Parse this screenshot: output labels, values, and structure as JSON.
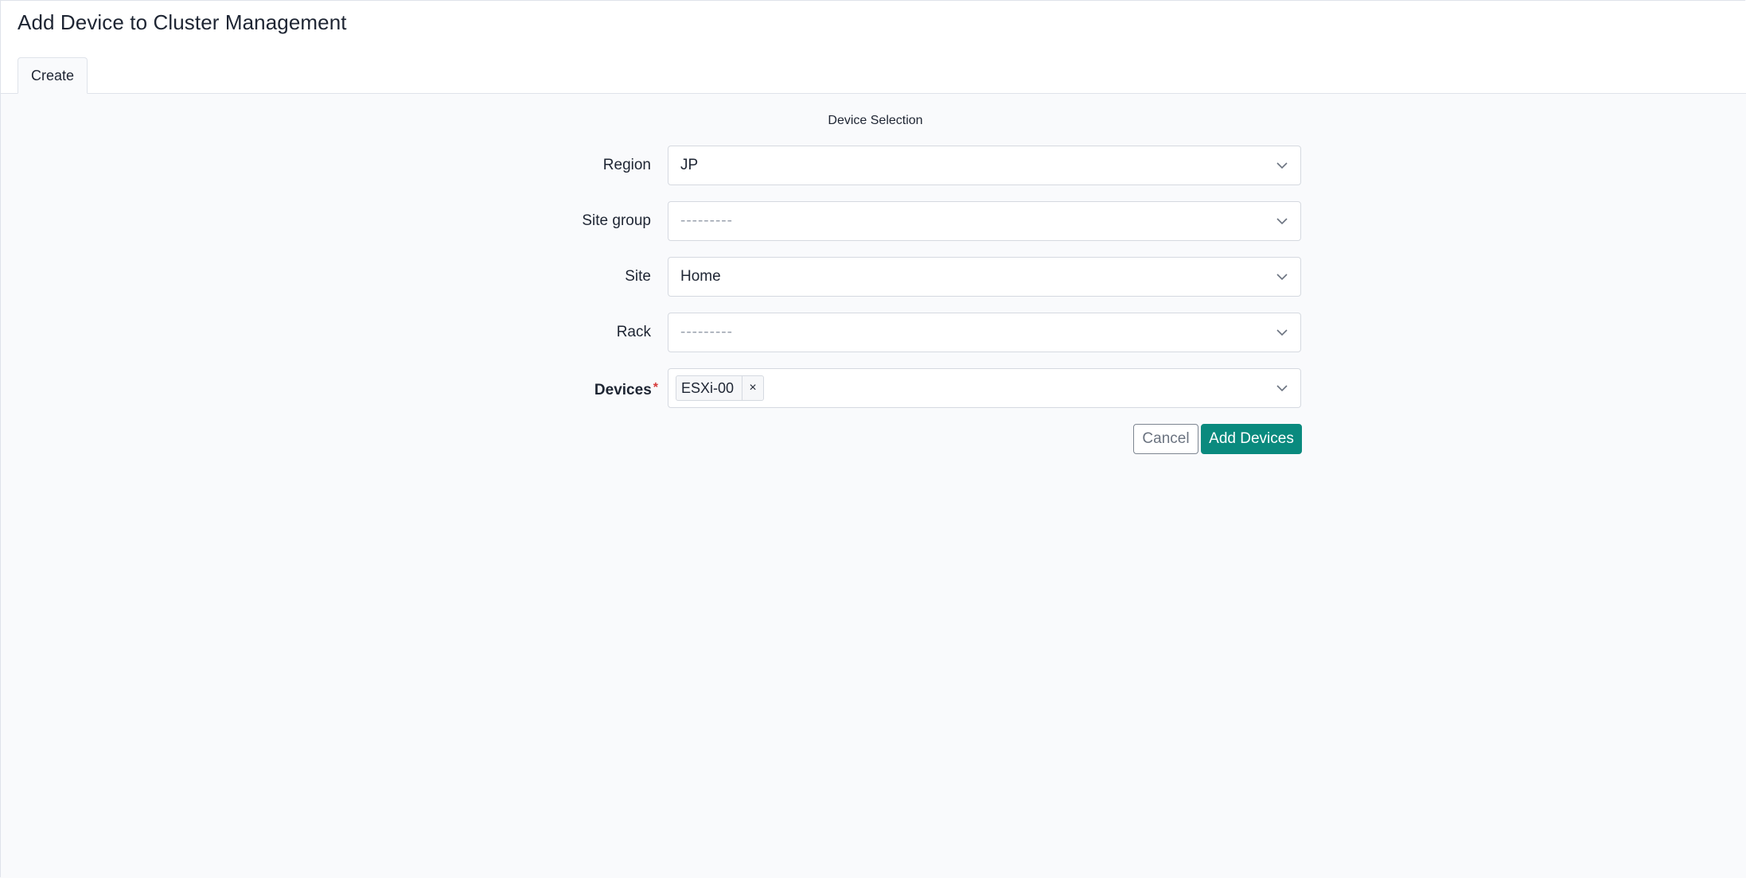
{
  "page": {
    "title": "Add Device to Cluster Management"
  },
  "tabs": [
    {
      "label": "Create",
      "active": true
    }
  ],
  "form": {
    "section_title": "Device Selection",
    "fields": {
      "region": {
        "label": "Region",
        "value": "JP"
      },
      "site_group": {
        "label": "Site group",
        "placeholder": "---------"
      },
      "site": {
        "label": "Site",
        "value": "Home"
      },
      "rack": {
        "label": "Rack",
        "placeholder": "---------"
      },
      "devices": {
        "label": "Devices",
        "required_mark": "*",
        "selected": [
          "ESXi-00"
        ],
        "remove_glyph": "×"
      }
    },
    "buttons": {
      "cancel": "Cancel",
      "submit": "Add Devices"
    }
  },
  "colors": {
    "accent": "#0a8a7e",
    "required": "#d63939",
    "background": "#f9fafc"
  },
  "icons": {
    "select_arrow": "chevron-down-icon"
  }
}
